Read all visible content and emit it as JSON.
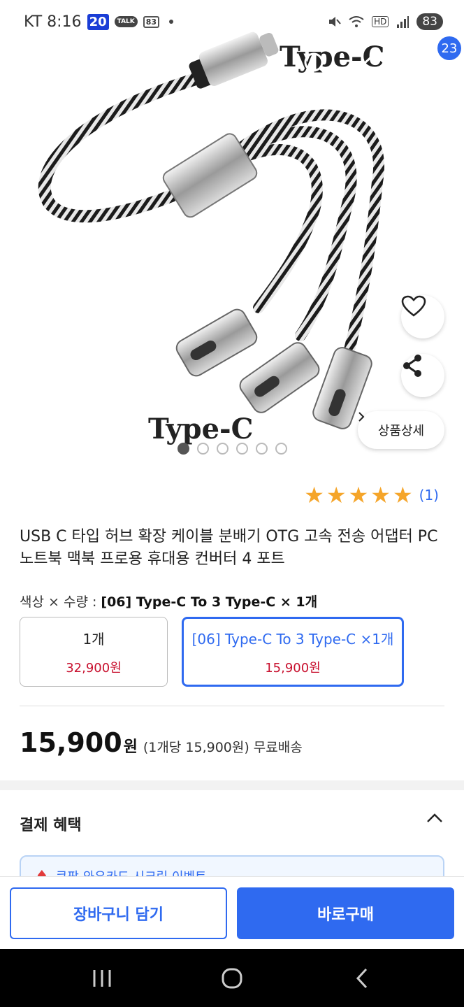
{
  "status_bar": {
    "carrier_time": "KT 8:16",
    "badge_number": "20",
    "talk_badge": "TALK",
    "calendar_badge": "83",
    "battery": "83",
    "hd_label": "HD"
  },
  "header": {
    "cart_count": "23"
  },
  "hero": {
    "type_label_top": "Type-C",
    "type_label_bottom": "Type-C",
    "detail_button": "상품상세",
    "image_count": 6,
    "current_image": 1
  },
  "rating": {
    "stars": 5,
    "count": "(1)"
  },
  "product": {
    "title": "USB C 타입 허브 확장 케이블 분배기 OTG 고속 전송 어댑터 PC 노트북 맥북 프로용 휴대용 컨버터 4 포트"
  },
  "options": {
    "label_prefix": "색상 × 수량 : ",
    "label_value": "[06] Type-C To 3 Type-C × 1개",
    "cards": [
      {
        "name": "1개",
        "price": "32,900원"
      },
      {
        "name": "[06] Type-C To 3 Type-C ×1개",
        "price": "15,900원"
      }
    ]
  },
  "price": {
    "amount": "15,900",
    "won": "원",
    "detail": "(1개당 15,900원) 무료배송"
  },
  "benefits": {
    "title": "결제 혜택",
    "coupon_text": "쿠팡 와우카드 시크릿 이벤트"
  },
  "actions": {
    "cart_button": "장바구니 담기",
    "buy_button": "바로구매"
  },
  "colors": {
    "accent": "#2f6af0",
    "price_red": "#c8102e",
    "star": "#f5a52a"
  }
}
